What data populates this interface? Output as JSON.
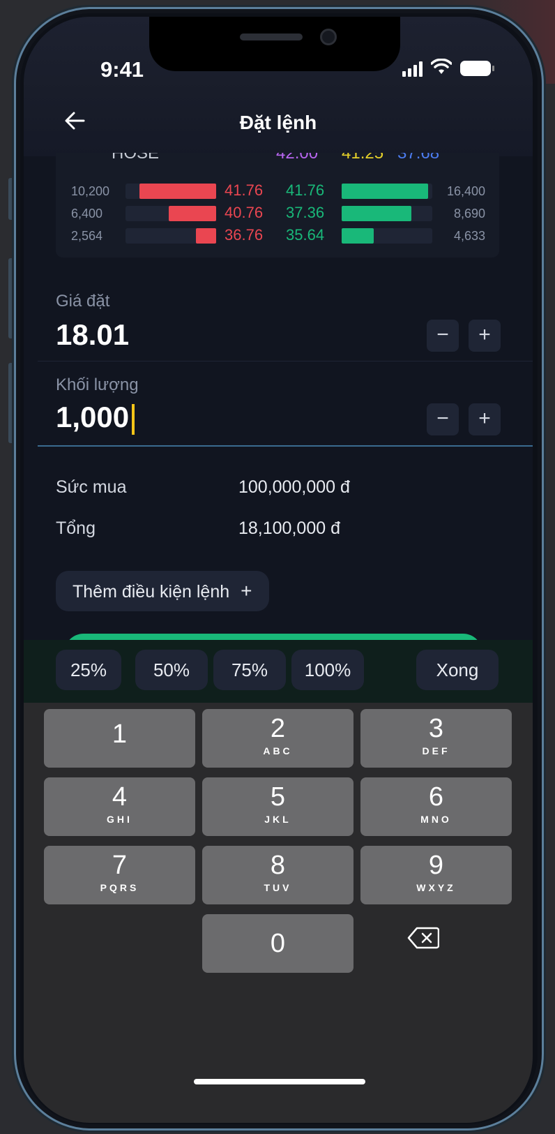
{
  "status_bar": {
    "time": "9:41"
  },
  "header": {
    "back_icon": "arrow-left-icon",
    "title": "Đặt lệnh"
  },
  "order_book": {
    "head": {
      "label": "HOSE",
      "p1": "42.00",
      "p2": "41.25",
      "p3": "37.68"
    },
    "colors": {
      "bid": "#ea4651",
      "ask": "#19b879",
      "head_purple": "#b866f0",
      "head_yellow": "#e6d12a",
      "head_blue": "#4c7cf0"
    },
    "rows": [
      {
        "bid_qty": "10,200",
        "bid_price": "41.76",
        "ask_price": "41.76",
        "ask_qty": "16,400",
        "bid_fill": 0.85,
        "ask_fill": 0.95
      },
      {
        "bid_qty": "6,400",
        "bid_price": "40.76",
        "ask_price": "37.36",
        "ask_qty": "8,690",
        "bid_fill": 0.52,
        "ask_fill": 0.77
      },
      {
        "bid_qty": "2,564",
        "bid_price": "36.76",
        "ask_price": "35.64",
        "ask_qty": "4,633",
        "bid_fill": 0.22,
        "ask_fill": 0.35
      }
    ]
  },
  "price": {
    "label": "Giá đặt",
    "value": "18.01",
    "minus": "−",
    "plus": "+"
  },
  "volume": {
    "label": "Khối lượng",
    "value": "1,000",
    "minus": "−",
    "plus": "+"
  },
  "summary": [
    {
      "label": "Sức mua",
      "value": "100,000,000 đ"
    },
    {
      "label": "Tổng",
      "value": "18,100,000 đ"
    }
  ],
  "condition_button": {
    "label": "Thêm điều kiện lệnh",
    "icon": "+"
  },
  "percent_buttons": [
    "25%",
    "50%",
    "75%",
    "100%"
  ],
  "done_button": "Xong",
  "keypad": [
    {
      "num": "1",
      "letters": ""
    },
    {
      "num": "2",
      "letters": "ABC"
    },
    {
      "num": "3",
      "letters": "DEF"
    },
    {
      "num": "4",
      "letters": "GHI"
    },
    {
      "num": "5",
      "letters": "JKL"
    },
    {
      "num": "6",
      "letters": "MNO"
    },
    {
      "num": "7",
      "letters": "PQRS"
    },
    {
      "num": "8",
      "letters": "TUV"
    },
    {
      "num": "9",
      "letters": "WXYZ"
    },
    {
      "num": "0",
      "letters": ""
    }
  ],
  "delete_key_icon": "backspace-icon"
}
